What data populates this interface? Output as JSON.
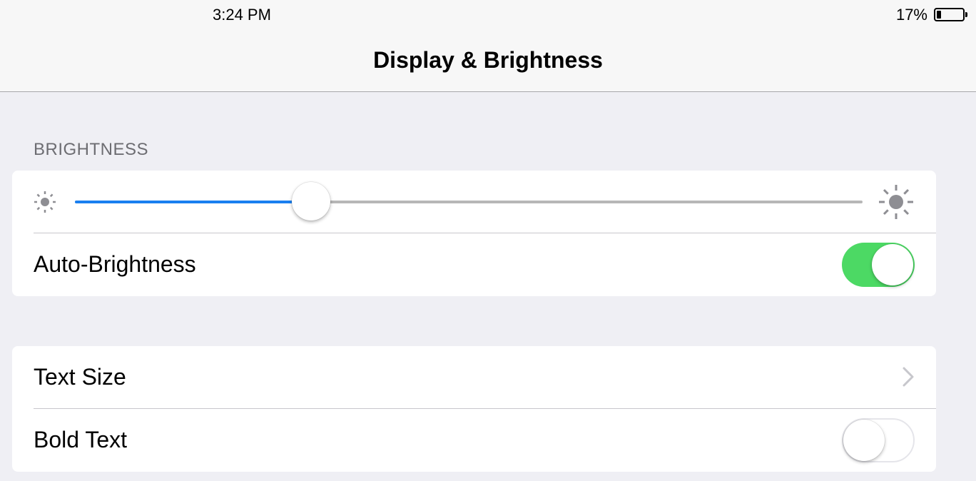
{
  "status_bar": {
    "time": "3:24 PM",
    "battery_percent_text": "17%",
    "battery_level": 0.17
  },
  "nav": {
    "title": "Display & Brightness"
  },
  "brightness_section": {
    "header": "BRIGHTNESS",
    "slider_value": 0.3,
    "min_icon": "sun-small-icon",
    "max_icon": "sun-large-icon",
    "auto_brightness": {
      "label": "Auto-Brightness",
      "on": true
    }
  },
  "text_section": {
    "text_size": {
      "label": "Text Size",
      "icon": "chevron-right-icon"
    },
    "bold_text": {
      "label": "Bold Text",
      "on": false
    }
  },
  "colors": {
    "toggle_on": "#4cd964",
    "slider_fill": "#1a7ff0",
    "background": "#efeff4"
  }
}
